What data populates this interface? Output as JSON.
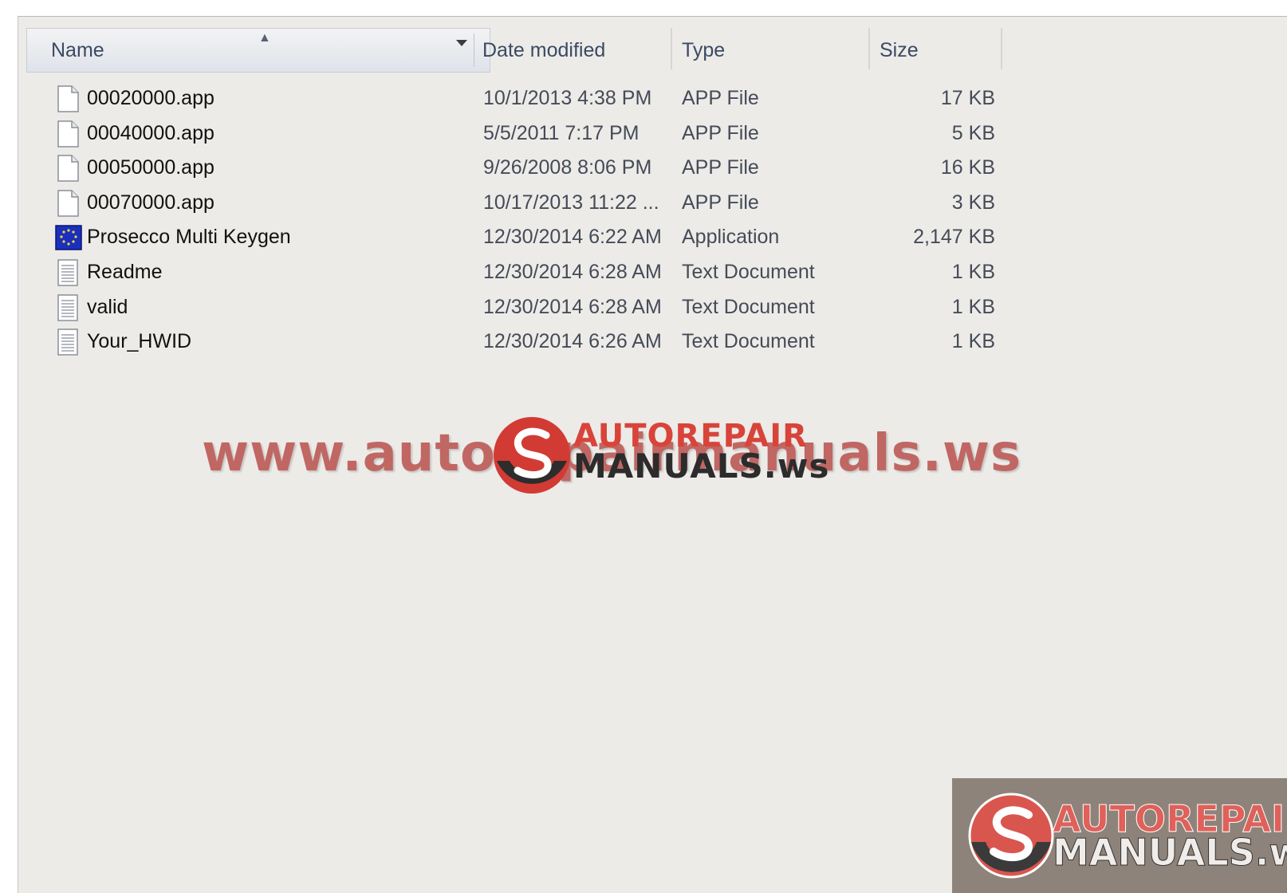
{
  "columns": {
    "name": "Name",
    "date": "Date modified",
    "type": "Type",
    "size": "Size"
  },
  "sort": {
    "column": "Name",
    "direction": "ascending",
    "icon": "sort-up-icon"
  },
  "files": [
    {
      "name": "00020000.app",
      "date": "10/1/2013 4:38 PM",
      "type": "APP File",
      "size": "17 KB",
      "icon": "blank-file-icon"
    },
    {
      "name": "00040000.app",
      "date": "5/5/2011 7:17 PM",
      "type": "APP File",
      "size": "5 KB",
      "icon": "blank-file-icon"
    },
    {
      "name": "00050000.app",
      "date": "9/26/2008 8:06 PM",
      "type": "APP File",
      "size": "16 KB",
      "icon": "blank-file-icon"
    },
    {
      "name": "00070000.app",
      "date": "10/17/2013 11:22 ...",
      "type": "APP File",
      "size": "3 KB",
      "icon": "blank-file-icon"
    },
    {
      "name": "Prosecco Multi Keygen",
      "date": "12/30/2014 6:22 AM",
      "type": "Application",
      "size": "2,147 KB",
      "icon": "application-icon"
    },
    {
      "name": "Readme",
      "date": "12/30/2014 6:28 AM",
      "type": "Text Document",
      "size": "1 KB",
      "icon": "text-document-icon"
    },
    {
      "name": "valid",
      "date": "12/30/2014 6:28 AM",
      "type": "Text Document",
      "size": "1 KB",
      "icon": "text-document-icon"
    },
    {
      "name": "Your_HWID",
      "date": "12/30/2014 6:26 AM",
      "type": "Text Document",
      "size": "1 KB",
      "icon": "text-document-icon"
    }
  ],
  "watermark": {
    "url_text": "www.autorepairmanuals.ws",
    "logo_top": "AUTOREPAIR",
    "logo_bottom": "MANUALS.ws"
  },
  "corner_logo": {
    "top": "AUTOREPAIR",
    "bottom": "MANUALS.ws"
  },
  "colors": {
    "background": "#ecebe8",
    "header_text": "#3b4a63",
    "watermark_red": "#b9504c",
    "logo_red": "#d8443a"
  }
}
